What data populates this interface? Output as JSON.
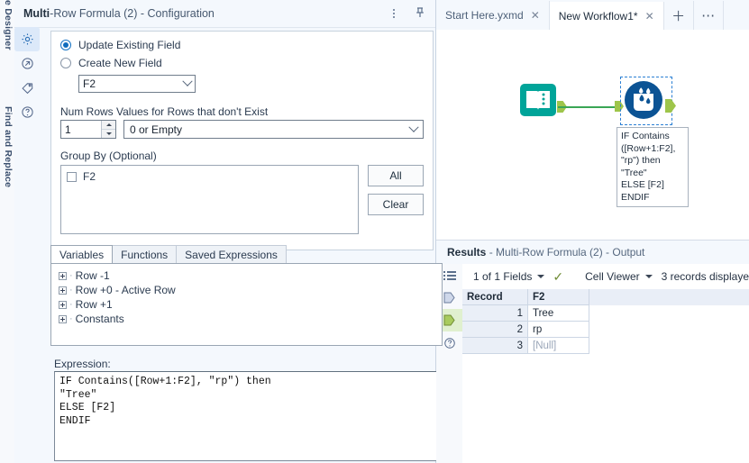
{
  "rail": {
    "label_top": "rface Designer",
    "label_bottom": "Find and Replace"
  },
  "config": {
    "title_bold": "Multi",
    "title_rest": "-Row Formula (2) - Configuration",
    "icons": [
      {
        "name": "gear-icon",
        "label": "Configuration"
      },
      {
        "name": "arrow-circle-icon",
        "label": "Output"
      },
      {
        "name": "tag-icon",
        "label": "Annotation"
      },
      {
        "name": "help-icon",
        "label": "Help"
      }
    ],
    "update_existing_label": "Update Existing Field",
    "create_new_label": "Create New  Field",
    "field_value": "F2",
    "num_rows_label": "Num Rows",
    "num_rows_value": "1",
    "values_label": "Values for Rows that don't Exist",
    "values_value": "0 or Empty",
    "group_by_label": "Group By (Optional)",
    "group_by_items": [
      "F2"
    ],
    "all_button": "All",
    "clear_button": "Clear",
    "tabs": [
      {
        "label": "Variables",
        "active": true
      },
      {
        "label": "Functions",
        "active": false
      },
      {
        "label": "Saved Expressions",
        "active": false
      }
    ],
    "tree_nodes": [
      "Row -1",
      "Row +0 - Active Row",
      "Row +1",
      "Constants"
    ],
    "expression_label": "Expression:",
    "expression": "IF Contains([Row+1:F2], \"rp\") then\n\"Tree\"\nELSE [F2]\nENDIF"
  },
  "workspace": {
    "tabs": [
      {
        "label": "Start Here.yxmd",
        "close": "✕",
        "active": false
      },
      {
        "label": "New Workflow1*",
        "close": "✕",
        "active": true
      }
    ],
    "new_tab_glyph": "＋",
    "more_tab_glyph": "⋯"
  },
  "canvas": {
    "annotation": "IF Contains\n([Row+1:F2],\n\"rp\") then\n\"Tree\"\nELSE [F2]\nENDIF",
    "input_tool_name": "input-data-tool",
    "formula_tool_name": "multi-row-formula-tool",
    "connector_color": "#3aa655",
    "anchor_color": "#9ec54a",
    "input_tool_color": "#00a499",
    "formula_tool_color": "#0b5394"
  },
  "results": {
    "header_bold": "Results",
    "header_rest": " - Multi-Row Formula (2) - Output",
    "fields_selector": "1 of 1 Fields",
    "check_glyph": "✓",
    "view_selector": "Cell Viewer",
    "records_text": "3 records displaye",
    "columns": [
      "Record",
      "F2"
    ],
    "rows": [
      {
        "record": "1",
        "value": "Tree",
        "null": false
      },
      {
        "record": "2",
        "value": "rp",
        "null": false
      },
      {
        "record": "3",
        "value": "[Null]",
        "null": true
      }
    ]
  }
}
